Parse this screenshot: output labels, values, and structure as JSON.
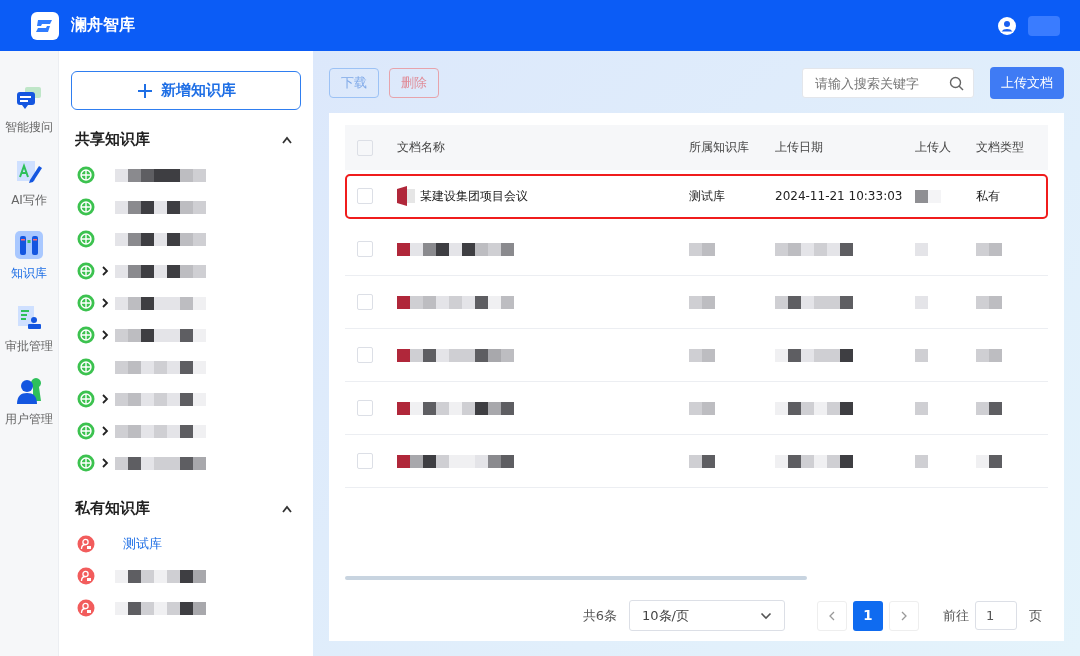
{
  "app": {
    "title": "澜舟智库"
  },
  "nav": [
    {
      "label": "智能搜问",
      "selected": false
    },
    {
      "label": "AI写作",
      "selected": false
    },
    {
      "label": "知识库",
      "selected": true
    },
    {
      "label": "审批管理",
      "selected": false
    },
    {
      "label": "用户管理",
      "selected": false
    }
  ],
  "library_panel": {
    "new_button": "新增知识库",
    "sections": [
      {
        "title": "共享知识库",
        "expanded": true,
        "kind": "shared",
        "items": [
          {
            "expandable": false,
            "selected": false
          },
          {
            "expandable": false,
            "selected": false
          },
          {
            "expandable": false,
            "selected": false
          },
          {
            "expandable": true,
            "selected": false
          },
          {
            "expandable": true,
            "selected": false
          },
          {
            "expandable": true,
            "selected": false
          },
          {
            "expandable": false,
            "selected": false
          },
          {
            "expandable": true,
            "selected": false
          },
          {
            "expandable": true,
            "selected": false
          },
          {
            "expandable": true,
            "selected": false
          }
        ]
      },
      {
        "title": "私有知识库",
        "expanded": true,
        "kind": "private",
        "items": [
          {
            "label": "测试库",
            "expandable": false,
            "selected": true
          },
          {
            "expandable": false,
            "selected": false
          },
          {
            "expandable": false,
            "selected": false
          }
        ]
      }
    ]
  },
  "toolbar": {
    "download": "下载",
    "delete": "删除",
    "search": {
      "placeholder": "请输入搜索关键字"
    },
    "upload": "上传文档"
  },
  "table": {
    "select_all_checked": false,
    "columns": [
      "文档名称",
      "所属知识库",
      "上传日期",
      "上传人",
      "文档类型"
    ],
    "rows": [
      {
        "kind": "document",
        "name": "某建设集团项目会议",
        "library": "测试库",
        "date": "2024-11-21 10:33:03",
        "type": "私有",
        "highlighted": true,
        "checked": false
      },
      {
        "kind": "redacted",
        "highlighted": false,
        "checked": false
      },
      {
        "kind": "redacted",
        "highlighted": false,
        "checked": false
      },
      {
        "kind": "redacted",
        "highlighted": false,
        "checked": false
      },
      {
        "kind": "redacted",
        "highlighted": false,
        "checked": false
      },
      {
        "kind": "redacted",
        "highlighted": false,
        "checked": false
      }
    ]
  },
  "pagination": {
    "total": "共6条",
    "page_size": "10条/页",
    "pages": [
      {
        "label": "1",
        "selected": true
      }
    ],
    "goto_label": "前往",
    "goto_value": "1",
    "goto_unit": "页"
  }
}
